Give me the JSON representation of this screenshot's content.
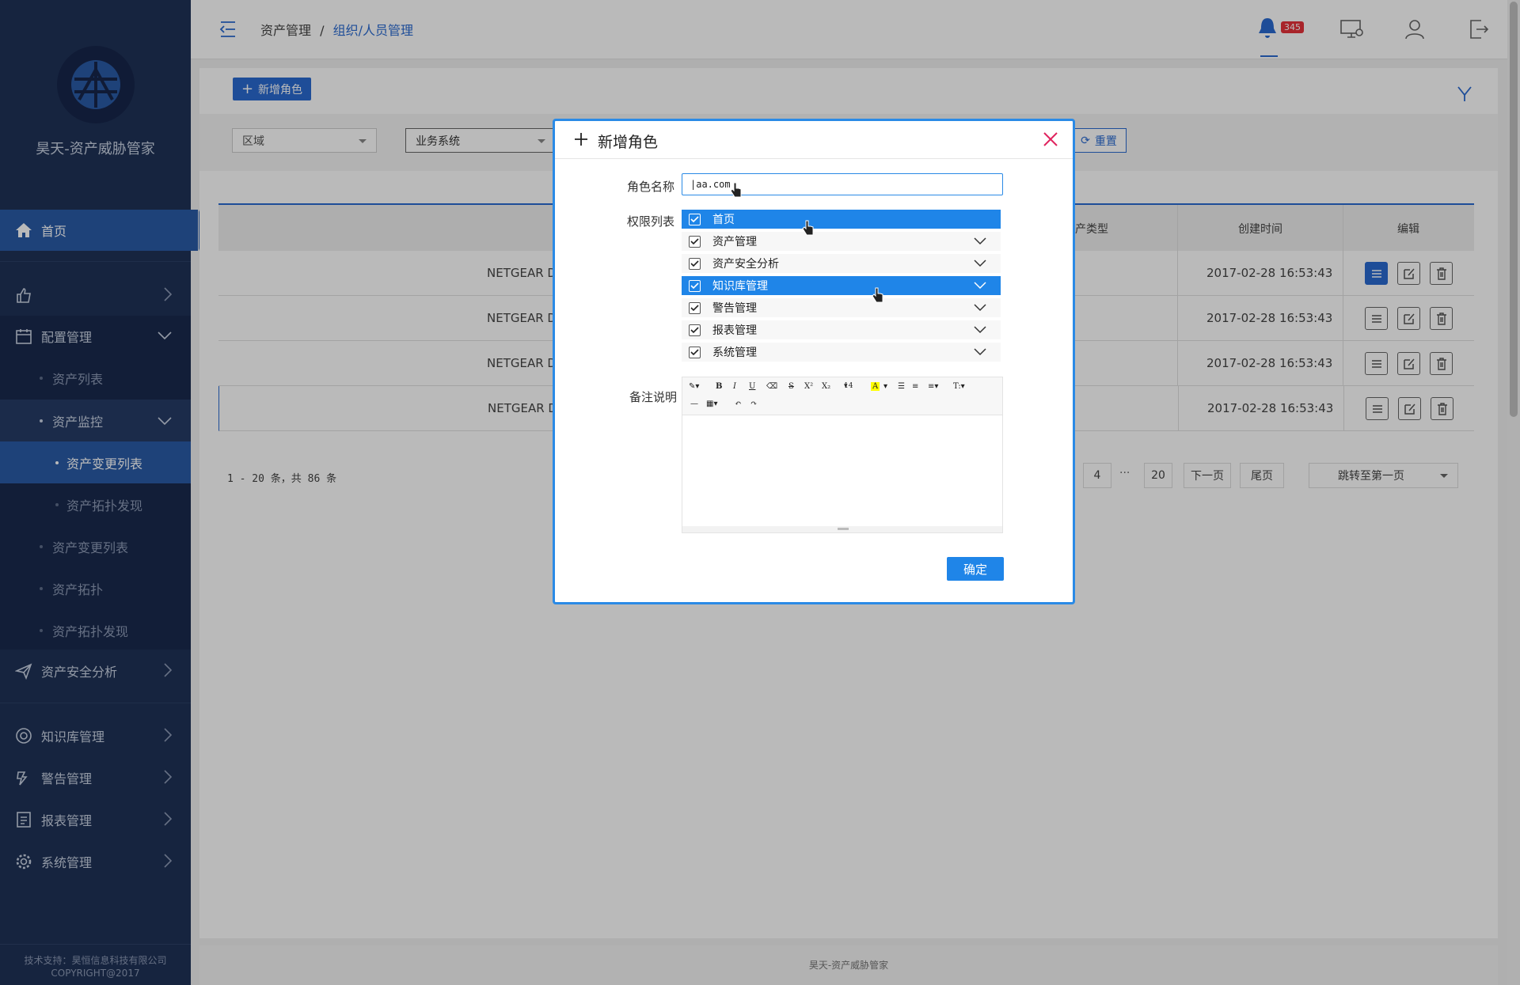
{
  "app": {
    "brand": "昊天-资产威胁管家",
    "footer_support": "技术支持：昊恒信息科技有限公司",
    "footer_copyright": "COPYRIGHT@2017",
    "footer_center": "昊天-资产威胁管家"
  },
  "sidebar": {
    "home": "首页",
    "config": "配置管理",
    "asset_list": "资产列表",
    "asset_monitor": "资产监控",
    "asset_change_list_active": "资产变更列表",
    "asset_topo_discover_sub": "资产拓扑发现",
    "asset_change_list": "资产变更列表",
    "asset_topo": "资产拓扑",
    "asset_topo_discover": "资产拓扑发现",
    "security": "资产安全分析",
    "knowledge": "知识库管理",
    "alert": "警告管理",
    "report": "报表管理",
    "system": "系统管理"
  },
  "topbar": {
    "crumb_parent": "资产管理",
    "crumb_sep": "/",
    "crumb_current": "组织/人员管理",
    "badge": "345"
  },
  "page": {
    "add_role": "新增角色",
    "filter_region": "区域",
    "filter_business": "业务系统",
    "reset": "重置",
    "col_asset_type": "产类型",
    "col_created": "创建时间",
    "col_edit": "编辑",
    "rows": [
      {
        "name": "NETGEAR D",
        "time": "2017-02-28 16:53:43"
      },
      {
        "name": "NETGEAR D",
        "time": "2017-02-28 16:53:43"
      },
      {
        "name": "NETGEAR D",
        "time": "2017-02-28 16:53:43"
      },
      {
        "name": "NETGEAR D",
        "time": "2017-02-28 16:53:43"
      }
    ],
    "summary": "1 - 20 条，共 86 条",
    "pages": {
      "p4": "4",
      "ellipsis": "···",
      "p20": "20",
      "next": "下一页",
      "last": "尾页",
      "jump": "跳转至第一页"
    }
  },
  "modal": {
    "title": "新增角色",
    "name_label": "角色名称",
    "name_value": "aa.com",
    "perm_label": "权限列表",
    "perms": [
      "首页",
      "资产管理",
      "资产安全分析",
      "知识库管理",
      "警告管理",
      "报表管理",
      "系统管理"
    ],
    "note_label": "备注说明",
    "font_size": "14",
    "confirm": "确定"
  },
  "colors": {
    "sidebar": "#1f3257",
    "accent": "#2a6ad1",
    "modal_border": "#2a8ae6",
    "close": "#e0245e"
  }
}
